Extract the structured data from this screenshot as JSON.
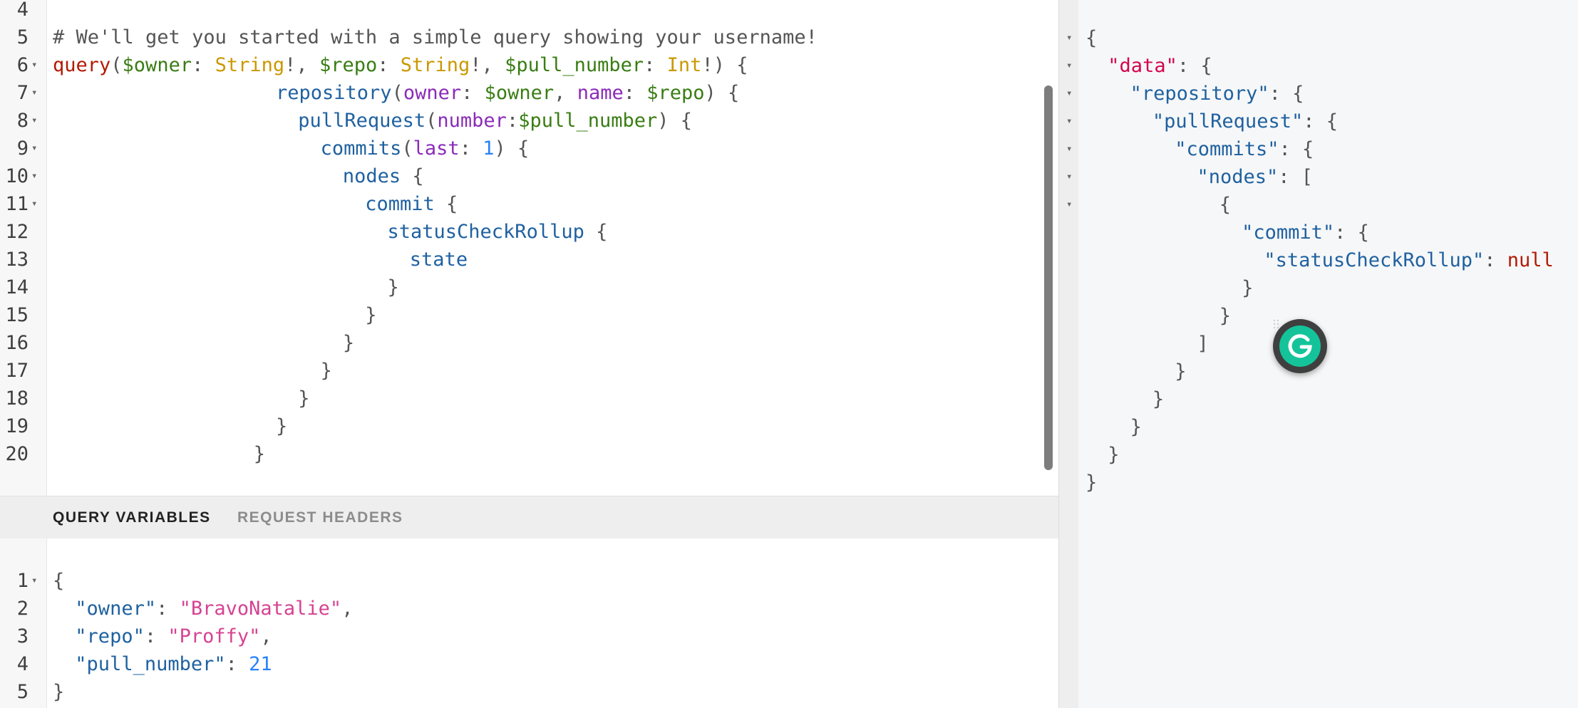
{
  "query_editor": {
    "lines": [
      {
        "num": "4",
        "fold": false,
        "indent": 0,
        "tokens": []
      },
      {
        "num": "5",
        "fold": false,
        "indent": 0,
        "tokens": [
          {
            "t": "# We'll get you started with a simple query showing your username!",
            "c": "comment"
          }
        ]
      },
      {
        "num": "6",
        "fold": true,
        "indent": 0,
        "tokens": [
          {
            "t": "query",
            "c": "kw"
          },
          {
            "t": "(",
            "c": "punct"
          },
          {
            "t": "$owner",
            "c": "var"
          },
          {
            "t": ": ",
            "c": "punct"
          },
          {
            "t": "String",
            "c": "type"
          },
          {
            "t": "!, ",
            "c": "punct"
          },
          {
            "t": "$repo",
            "c": "var"
          },
          {
            "t": ": ",
            "c": "punct"
          },
          {
            "t": "String",
            "c": "type"
          },
          {
            "t": "!, ",
            "c": "punct"
          },
          {
            "t": "$pull_number",
            "c": "var"
          },
          {
            "t": ": ",
            "c": "punct"
          },
          {
            "t": "Int",
            "c": "type"
          },
          {
            "t": "!) {",
            "c": "punct"
          }
        ]
      },
      {
        "num": "7",
        "fold": true,
        "indent": 10,
        "tokens": [
          {
            "t": "repository",
            "c": "field"
          },
          {
            "t": "(",
            "c": "punct"
          },
          {
            "t": "owner",
            "c": "arg"
          },
          {
            "t": ": ",
            "c": "punct"
          },
          {
            "t": "$owner",
            "c": "var"
          },
          {
            "t": ", ",
            "c": "punct"
          },
          {
            "t": "name",
            "c": "arg"
          },
          {
            "t": ": ",
            "c": "punct"
          },
          {
            "t": "$repo",
            "c": "var"
          },
          {
            "t": ") {",
            "c": "punct"
          }
        ]
      },
      {
        "num": "8",
        "fold": true,
        "indent": 11,
        "tokens": [
          {
            "t": "pullRequest",
            "c": "field"
          },
          {
            "t": "(",
            "c": "punct"
          },
          {
            "t": "number",
            "c": "arg"
          },
          {
            "t": ":",
            "c": "punct"
          },
          {
            "t": "$pull_number",
            "c": "var"
          },
          {
            "t": ") {",
            "c": "punct"
          }
        ]
      },
      {
        "num": "9",
        "fold": true,
        "indent": 12,
        "tokens": [
          {
            "t": "commits",
            "c": "field"
          },
          {
            "t": "(",
            "c": "punct"
          },
          {
            "t": "last",
            "c": "arg"
          },
          {
            "t": ": ",
            "c": "punct"
          },
          {
            "t": "1",
            "c": "num"
          },
          {
            "t": ") {",
            "c": "punct"
          }
        ]
      },
      {
        "num": "10",
        "fold": true,
        "indent": 13,
        "tokens": [
          {
            "t": "nodes",
            "c": "field"
          },
          {
            "t": " {",
            "c": "punct"
          }
        ]
      },
      {
        "num": "11",
        "fold": true,
        "indent": 14,
        "tokens": [
          {
            "t": "commit",
            "c": "field"
          },
          {
            "t": " {",
            "c": "punct"
          }
        ]
      },
      {
        "num": "12",
        "fold": false,
        "indent": 15,
        "tokens": [
          {
            "t": "statusCheckRollup",
            "c": "field"
          },
          {
            "t": " {",
            "c": "punct"
          }
        ]
      },
      {
        "num": "13",
        "fold": false,
        "indent": 16,
        "tokens": [
          {
            "t": "state",
            "c": "field"
          }
        ]
      },
      {
        "num": "14",
        "fold": false,
        "indent": 15,
        "tokens": [
          {
            "t": "}",
            "c": "punct"
          }
        ]
      },
      {
        "num": "15",
        "fold": false,
        "indent": 14,
        "tokens": [
          {
            "t": "}",
            "c": "punct"
          }
        ]
      },
      {
        "num": "16",
        "fold": false,
        "indent": 13,
        "tokens": [
          {
            "t": "}",
            "c": "punct"
          }
        ]
      },
      {
        "num": "17",
        "fold": false,
        "indent": 12,
        "tokens": [
          {
            "t": "}",
            "c": "punct"
          }
        ]
      },
      {
        "num": "18",
        "fold": false,
        "indent": 11,
        "tokens": [
          {
            "t": "}",
            "c": "punct"
          }
        ]
      },
      {
        "num": "19",
        "fold": false,
        "indent": 10,
        "tokens": [
          {
            "t": "}",
            "c": "punct"
          }
        ]
      },
      {
        "num": "20",
        "fold": false,
        "indent": 9,
        "tokens": [
          {
            "t": "}",
            "c": "punct"
          }
        ]
      }
    ]
  },
  "variables_tabs": {
    "query_variables": "QUERY VARIABLES",
    "request_headers": "REQUEST HEADERS"
  },
  "variables_editor": {
    "lines": [
      {
        "num": "1",
        "fold": true,
        "indent": 0,
        "tokens": [
          {
            "t": "{",
            "c": "punct"
          }
        ]
      },
      {
        "num": "2",
        "fold": false,
        "indent": 1,
        "tokens": [
          {
            "t": "\"owner\"",
            "c": "prop"
          },
          {
            "t": ": ",
            "c": "punct"
          },
          {
            "t": "\"BravoNatalie\"",
            "c": "str"
          },
          {
            "t": ",",
            "c": "punct"
          }
        ]
      },
      {
        "num": "3",
        "fold": false,
        "indent": 1,
        "tokens": [
          {
            "t": "\"repo\"",
            "c": "prop"
          },
          {
            "t": ": ",
            "c": "punct"
          },
          {
            "t": "\"Proffy\"",
            "c": "str"
          },
          {
            "t": ",",
            "c": "punct"
          }
        ]
      },
      {
        "num": "4",
        "fold": false,
        "indent": 1,
        "tokens": [
          {
            "t": "\"pull_number\"",
            "c": "prop"
          },
          {
            "t": ": ",
            "c": "punct"
          },
          {
            "t": "21",
            "c": "num"
          }
        ]
      },
      {
        "num": "5",
        "fold": false,
        "indent": 0,
        "tokens": [
          {
            "t": "}",
            "c": "punct"
          }
        ]
      }
    ]
  },
  "result_viewer": {
    "lines": [
      {
        "fold": true,
        "indent": 0,
        "tokens": [
          {
            "t": "{",
            "c": "punct"
          }
        ]
      },
      {
        "fold": true,
        "indent": 1,
        "tokens": [
          {
            "t": "\"data\"",
            "c": "datakey"
          },
          {
            "t": ": {",
            "c": "punct"
          }
        ]
      },
      {
        "fold": true,
        "indent": 2,
        "tokens": [
          {
            "t": "\"repository\"",
            "c": "resprop"
          },
          {
            "t": ": {",
            "c": "punct"
          }
        ]
      },
      {
        "fold": true,
        "indent": 3,
        "tokens": [
          {
            "t": "\"pullRequest\"",
            "c": "resprop"
          },
          {
            "t": ": {",
            "c": "punct"
          }
        ]
      },
      {
        "fold": true,
        "indent": 4,
        "tokens": [
          {
            "t": "\"commits\"",
            "c": "resprop"
          },
          {
            "t": ": {",
            "c": "punct"
          }
        ]
      },
      {
        "fold": true,
        "indent": 5,
        "tokens": [
          {
            "t": "\"nodes\"",
            "c": "resprop"
          },
          {
            "t": ": [",
            "c": "punct"
          }
        ]
      },
      {
        "fold": true,
        "indent": 6,
        "tokens": [
          {
            "t": "{",
            "c": "punct"
          }
        ]
      },
      {
        "fold": false,
        "indent": 7,
        "tokens": [
          {
            "t": "\"commit\"",
            "c": "resprop"
          },
          {
            "t": ": {",
            "c": "punct"
          }
        ]
      },
      {
        "fold": false,
        "indent": 8,
        "tokens": [
          {
            "t": "\"statusCheckRollup\"",
            "c": "resprop"
          },
          {
            "t": ": ",
            "c": "punct"
          },
          {
            "t": "null",
            "c": "nullv"
          }
        ]
      },
      {
        "fold": false,
        "indent": 7,
        "tokens": [
          {
            "t": "}",
            "c": "punct"
          }
        ]
      },
      {
        "fold": false,
        "indent": 6,
        "tokens": [
          {
            "t": "}",
            "c": "punct"
          }
        ]
      },
      {
        "fold": false,
        "indent": 5,
        "tokens": [
          {
            "t": "]",
            "c": "punct"
          }
        ]
      },
      {
        "fold": false,
        "indent": 4,
        "tokens": [
          {
            "t": "}",
            "c": "punct"
          }
        ]
      },
      {
        "fold": false,
        "indent": 3,
        "tokens": [
          {
            "t": "}",
            "c": "punct"
          }
        ]
      },
      {
        "fold": false,
        "indent": 2,
        "tokens": [
          {
            "t": "}",
            "c": "punct"
          }
        ]
      },
      {
        "fold": false,
        "indent": 1,
        "tokens": [
          {
            "t": "}",
            "c": "punct"
          }
        ]
      },
      {
        "fold": false,
        "indent": 0,
        "tokens": [
          {
            "t": "}",
            "c": "punct"
          }
        ]
      }
    ]
  },
  "fold_glyph": "▾",
  "badge": {
    "icon": "grammarly-icon",
    "color": "#15c39a"
  }
}
